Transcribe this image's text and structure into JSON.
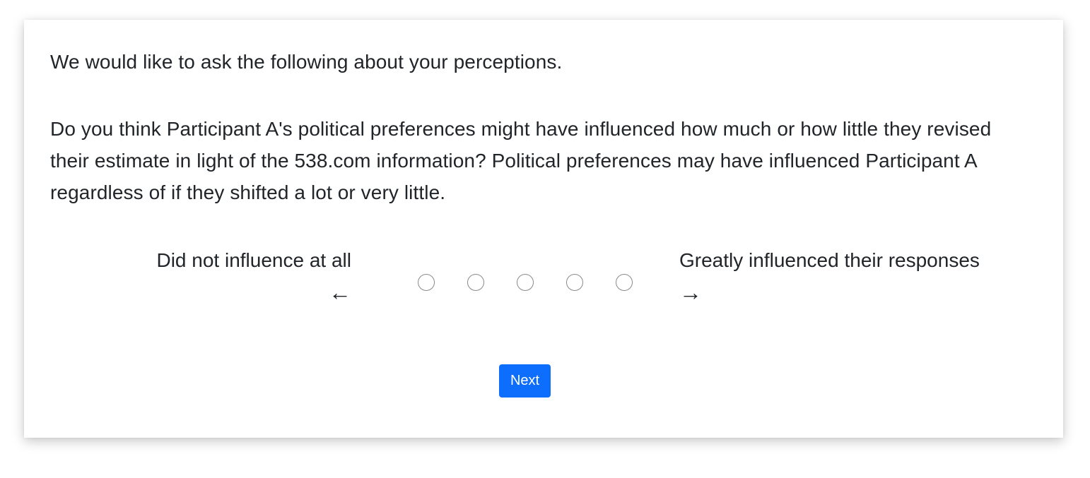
{
  "survey": {
    "intro": "We would like to ask the following about your perceptions.",
    "question": "Do you think Participant A's political preferences might have influenced how much or how little they revised their estimate in light of the 538.com information? Political preferences may have influenced Participant A regardless of if they shifted a lot or very little.",
    "scale": {
      "left_label": "Did not influence at all",
      "left_arrow": "←",
      "right_label": "Greatly influenced their responses",
      "right_arrow": "→",
      "options_count": 5,
      "selected": null
    },
    "next_label": "Next"
  },
  "colors": {
    "button_bg": "#0d6efd",
    "text": "#212529",
    "radio_border": "#8a8a8a"
  }
}
